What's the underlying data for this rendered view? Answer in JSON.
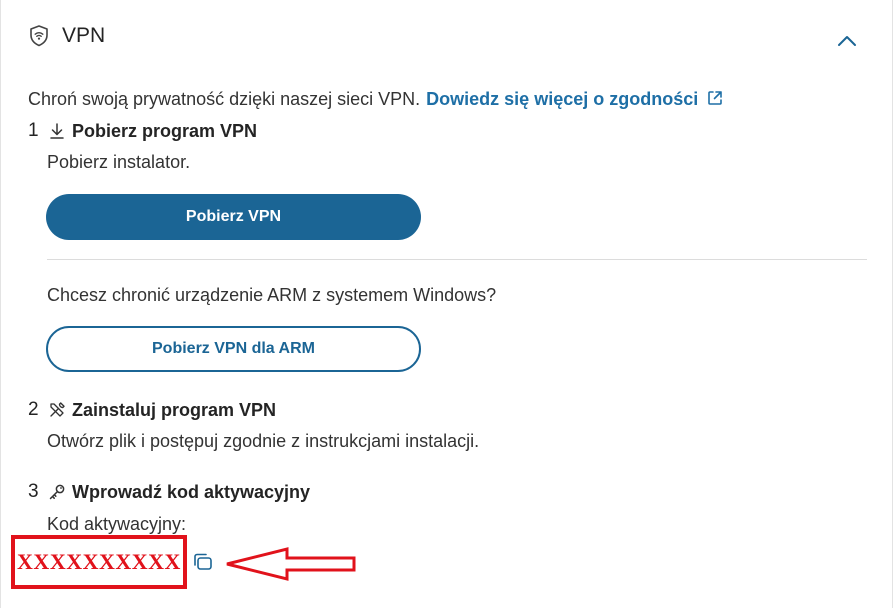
{
  "header": {
    "title": "VPN"
  },
  "intro": {
    "text": "Chroń swoją prywatność dzięki naszej sieci VPN.",
    "link": "Dowiedz się więcej o zgodności"
  },
  "steps": [
    {
      "number": "1",
      "title": "Pobierz program VPN",
      "description": "Pobierz instalator.",
      "button": "Pobierz VPN"
    },
    {
      "number": "2",
      "title": "Zainstaluj program VPN",
      "description": "Otwórz plik i postępuj zgodnie z instrukcjami instalacji."
    },
    {
      "number": "3",
      "title": "Wprowadź kod aktywacyjny",
      "description": "Kod aktywacyjny:"
    }
  ],
  "arm": {
    "question": "Chcesz chronić urządzenie ARM z systemem Windows?",
    "button": "Pobierz VPN dla ARM"
  },
  "activation": {
    "code": "XXXXXXXXXX"
  },
  "colors": {
    "accent": "#1b6595",
    "link": "#1e6fa6",
    "annotation": "#e1121b"
  }
}
